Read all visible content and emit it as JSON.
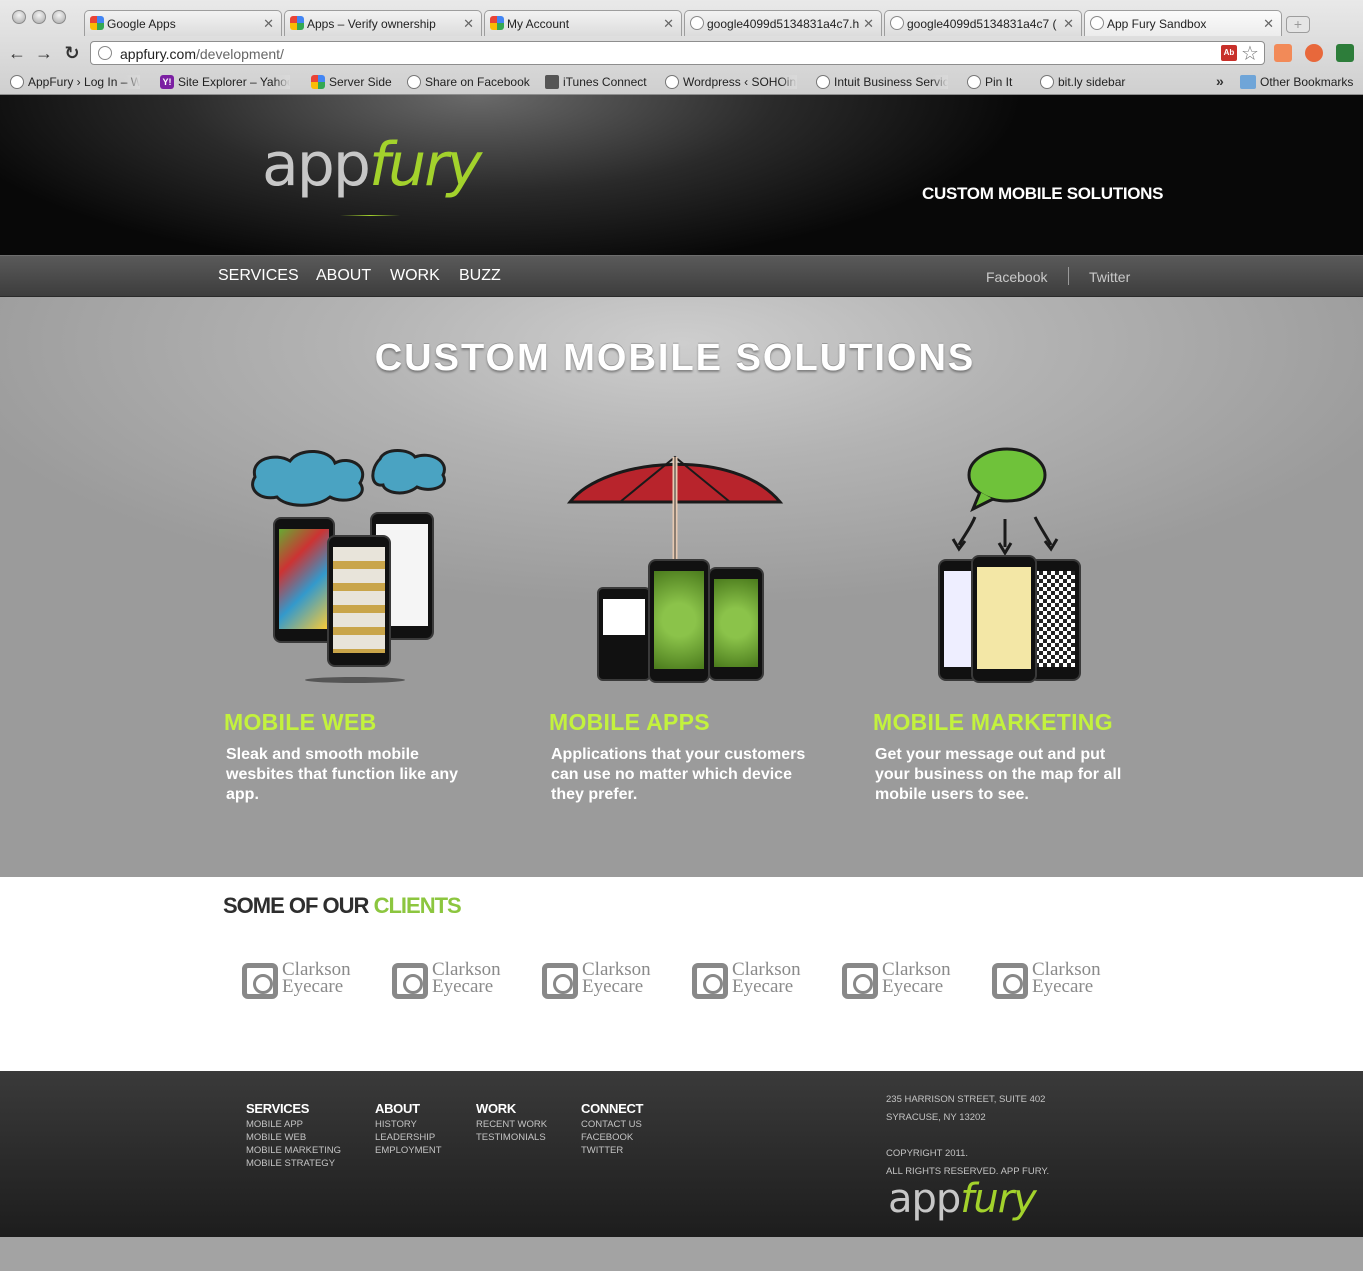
{
  "browser": {
    "tabs": [
      {
        "label": "Google Apps",
        "icon": "google-icon"
      },
      {
        "label": "Apps – Verify ownership",
        "icon": "google-icon"
      },
      {
        "label": "My Account",
        "icon": "google-icon"
      },
      {
        "label": "google4099d5134831a4c7.h",
        "icon": "globe-icon"
      },
      {
        "label": "google4099d5134831a4c7 (",
        "icon": "globe-icon"
      },
      {
        "label": "App Fury Sandbox",
        "icon": "globe-icon"
      }
    ],
    "url_host": "appfury.com",
    "url_path": "/development/",
    "bookmarks": [
      "AppFury › Log In – W",
      "Site Explorer – Yahoo",
      "Server Side",
      "Share on Facebook",
      "iTunes Connect",
      "Wordpress ‹ SOHOinn",
      "Intuit Business Servic",
      "Pin It",
      "bit.ly sidebar"
    ],
    "other_bookmarks": "Other Bookmarks",
    "overflow": "»",
    "pdf_badge": "Ab"
  },
  "header": {
    "logo_app": "app",
    "logo_fury": "fury",
    "tagline": "CUSTOM MOBILE SOLUTIONS"
  },
  "nav": {
    "items": [
      "SERVICES",
      "ABOUT",
      "WORK",
      "BUZZ"
    ],
    "social": [
      "Facebook",
      "Twitter"
    ]
  },
  "hero": {
    "title": "CUSTOM MOBILE SOLUTIONS",
    "features": [
      {
        "title": "MOBILE WEB",
        "desc": "Sleak and smooth mobile wesbites that function like any app."
      },
      {
        "title": "MOBILE APPS",
        "desc": "Applications that your customers can use no matter which device they prefer."
      },
      {
        "title": "MOBILE MARKETING",
        "desc": "Get your message out and put your business on the map for all mobile users to see."
      }
    ]
  },
  "clients": {
    "heading_dark": "SOME OF OUR",
    "heading_green": "CLIENTS",
    "logos": [
      {
        "line1": "Clarkson",
        "line2": "Eyecare"
      },
      {
        "line1": "Clarkson",
        "line2": "Eyecare"
      },
      {
        "line1": "Clarkson",
        "line2": "Eyecare"
      },
      {
        "line1": "Clarkson",
        "line2": "Eyecare"
      },
      {
        "line1": "Clarkson",
        "line2": "Eyecare"
      },
      {
        "line1": "Clarkson",
        "line2": "Eyecare"
      }
    ]
  },
  "footer": {
    "columns": [
      {
        "heading": "SERVICES",
        "links": [
          "MOBILE APP",
          "MOBILE WEB",
          "MOBILE MARKETING",
          "MOBILE STRATEGY"
        ]
      },
      {
        "heading": "ABOUT",
        "links": [
          "HISTORY",
          "LEADERSHIP",
          "EMPLOYMENT"
        ]
      },
      {
        "heading": "WORK",
        "links": [
          "RECENT WORK",
          "TESTIMONIALS"
        ]
      },
      {
        "heading": "CONNECT",
        "links": [
          "CONTACT US",
          "FACEBOOK",
          "TWITTER"
        ]
      }
    ],
    "address_line1": "235 HARRISON STREET, SUITE 402",
    "address_line2": "SYRACUSE, NY 13202",
    "copyright_line1": "COPYRIGHT 2011.",
    "copyright_line2": "ALL RIGHTS RESERVED. APP FURY.",
    "logo_app": "app",
    "logo_fury": "fury"
  },
  "colors": {
    "brand_green": "#a3d22c",
    "feature_title_green": "#c3f23d",
    "clients_green": "#8cc63f"
  }
}
